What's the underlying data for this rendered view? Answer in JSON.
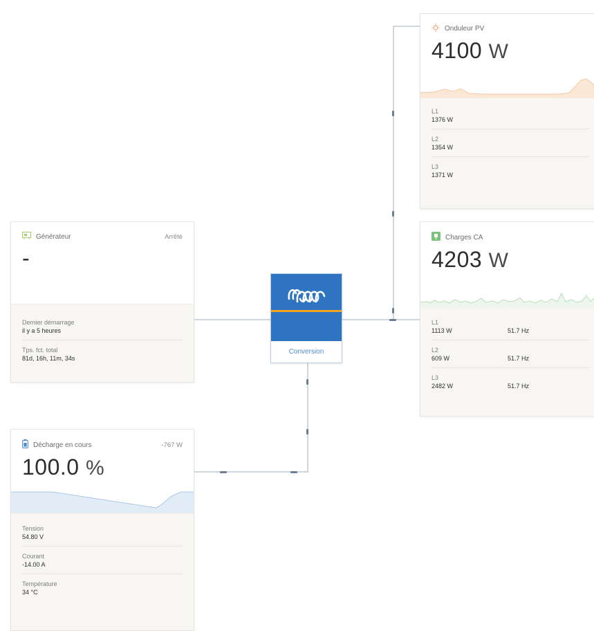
{
  "pv": {
    "title": "Onduleur PV",
    "value": "4100",
    "unit": "W",
    "phases": [
      {
        "label": "L1",
        "value": "1376 W"
      },
      {
        "label": "L2",
        "value": "1354 W"
      },
      {
        "label": "L3",
        "value": "1371 W"
      }
    ]
  },
  "generator": {
    "title": "Générateur",
    "status": "Arrêté",
    "value": "-",
    "details": [
      {
        "label": "Dernier démarrage",
        "value": "il y a 5 heures"
      },
      {
        "label": "Tps. fct. total",
        "value": "81d, 16h, 11m, 34s"
      }
    ]
  },
  "loads": {
    "title": "Charges CA",
    "value": "4203",
    "unit": "W",
    "phases": [
      {
        "label": "L1",
        "value": "1113 W",
        "freq": "51.7 Hz"
      },
      {
        "label": "L2",
        "value": "609 W",
        "freq": "51.7 Hz"
      },
      {
        "label": "L3",
        "value": "2482 W",
        "freq": "51.7 Hz"
      }
    ]
  },
  "converter": {
    "label": "Conversion"
  },
  "battery": {
    "title": "Décharge en cours",
    "power": "-767 W",
    "value": "100.0",
    "unit": "%",
    "details": [
      {
        "label": "Tension",
        "value": "54.80 V"
      },
      {
        "label": "Courant",
        "value": "-14.00 A"
      },
      {
        "label": "Température",
        "value": "34 °C"
      }
    ]
  },
  "colors": {
    "pv_accent": "#f0a070",
    "loads_accent": "#7cc27a",
    "battery_accent": "#4f8ccf",
    "generator_accent": "#a7c96a",
    "converter_blue": "#2f74c0",
    "converter_bar": "#f2a420"
  }
}
